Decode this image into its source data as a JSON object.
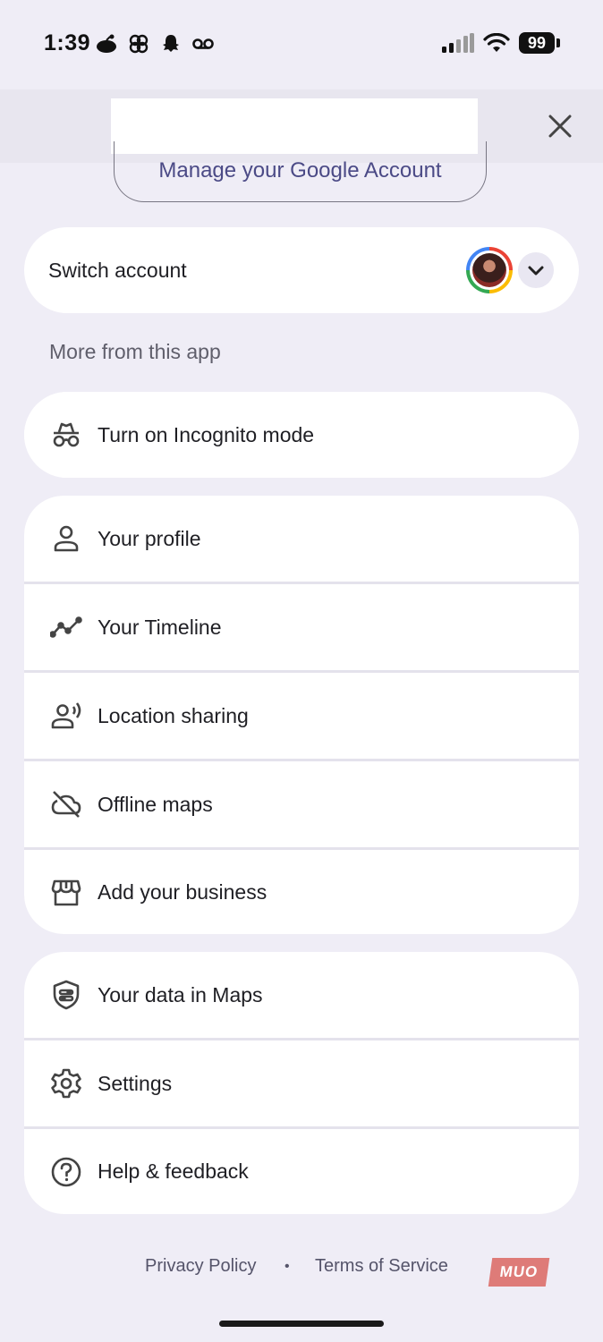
{
  "status_bar": {
    "time": "1:39",
    "battery": "99"
  },
  "header": {
    "manage_account": "Manage your Google Account"
  },
  "switch_account": {
    "label": "Switch account"
  },
  "section": {
    "more_from_app": "More from this app"
  },
  "incognito": {
    "label": "Turn on Incognito mode"
  },
  "group1": [
    {
      "label": "Your profile",
      "icon": "person-icon"
    },
    {
      "label": "Your Timeline",
      "icon": "timeline-icon"
    },
    {
      "label": "Location sharing",
      "icon": "location-sharing-icon"
    },
    {
      "label": "Offline maps",
      "icon": "offline-cloud-icon"
    },
    {
      "label": "Add your business",
      "icon": "storefront-icon"
    }
  ],
  "group2": [
    {
      "label": "Your data in Maps",
      "icon": "shield-data-icon"
    },
    {
      "label": "Settings",
      "icon": "gear-icon"
    },
    {
      "label": "Help & feedback",
      "icon": "help-icon"
    }
  ],
  "footer": {
    "privacy": "Privacy Policy",
    "dot": "•",
    "terms": "Terms of Service"
  },
  "watermark": "MUO"
}
